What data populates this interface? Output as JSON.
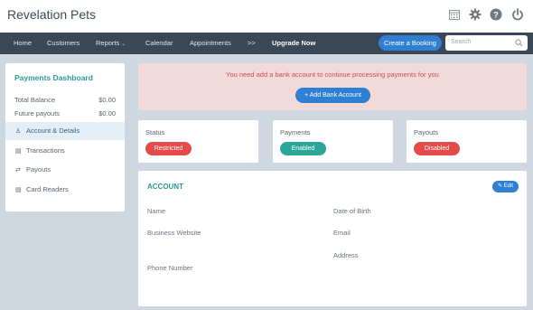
{
  "brand": "Revelation Pets",
  "top_icons": [
    "calendar-icon",
    "gear-icon",
    "help-icon",
    "power-icon"
  ],
  "nav": {
    "items": [
      "Home",
      "Customers",
      "Reports",
      "Calendar",
      "Appointments",
      ">>",
      "Upgrade Now"
    ],
    "reports_caret": "⌄",
    "booking_button": "Create a Booking",
    "search_placeholder": "Search"
  },
  "sidebar": {
    "title": "Payments Dashboard",
    "balances": [
      {
        "label": "Total Balance",
        "value": "$0.00"
      },
      {
        "label": "Future payouts",
        "value": "$0.00"
      }
    ],
    "links": [
      {
        "label": "Account & Details",
        "icon": "person-icon",
        "active": true
      },
      {
        "label": "Transactions",
        "icon": "card-list-icon"
      },
      {
        "label": "Payouts",
        "icon": "transfer-icon"
      },
      {
        "label": "Card Readers",
        "icon": "card-reader-icon"
      }
    ]
  },
  "alert": {
    "message": "You need add a bank account to continue processing payments for you",
    "button": "+ Add Bank Account"
  },
  "status_cards": [
    {
      "title": "Status",
      "badge": "Restricted",
      "color": "#e34b4b"
    },
    {
      "title": "Payments",
      "badge": "Enabled",
      "color": "#2ba699"
    },
    {
      "title": "Payouts",
      "badge": "Disabled",
      "color": "#e34b4b"
    }
  ],
  "account": {
    "title": "ACCOUNT",
    "edit_button": "✎ Edit",
    "fields_left": [
      "Name",
      "Business Website",
      "Phone Number"
    ],
    "fields_right": [
      "Date of Birth",
      "Email",
      "Address"
    ]
  },
  "colors": {
    "accent": "#2f7fd3",
    "teal": "#2b9a98",
    "nav_bg": "#3a4756",
    "page_bg": "#cfd8e0",
    "alert_bg": "#f2dada",
    "alert_text": "#c9504c"
  }
}
